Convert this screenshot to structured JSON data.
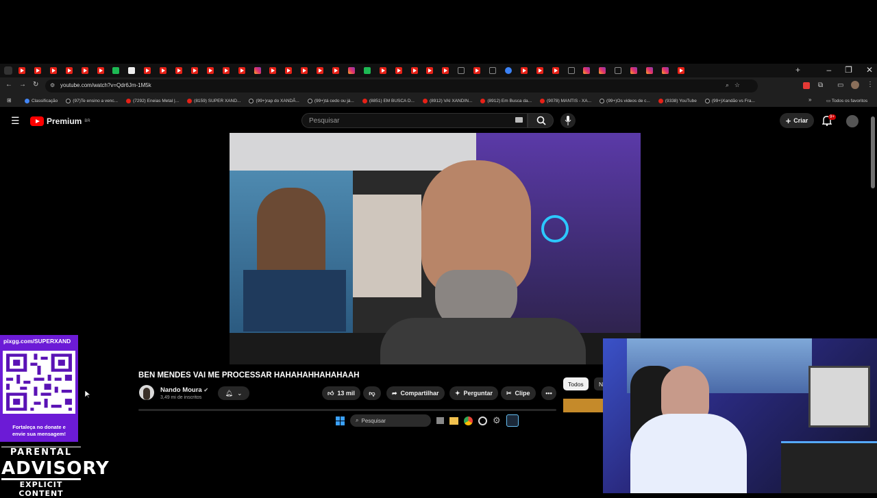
{
  "browser": {
    "url": "youtube.com/watch?v=Qdr6Jm-1M5k",
    "tab_types": [
      "yt",
      "yt",
      "yt",
      "yt",
      "yt",
      "yt",
      "gr",
      "wh",
      "yt",
      "yt",
      "yt",
      "yt",
      "yt",
      "yt",
      "yt",
      "ig",
      "yt",
      "yt",
      "yt",
      "yt",
      "yt",
      "ig",
      "gr",
      "yt",
      "yt",
      "yt",
      "yt",
      "yt",
      "tt",
      "yt",
      "tt",
      "bl",
      "yt",
      "yt",
      "yt",
      "tt",
      "ig",
      "ig",
      "tt",
      "ig",
      "ig",
      "ig",
      "yt"
    ],
    "bookmarks": [
      {
        "label": "Classificação",
        "icon": "g"
      },
      {
        "label": "(97)Te ensino a venc...",
        "icon": "t"
      },
      {
        "label": "(7292) Eneias Metal |...",
        "icon": "y"
      },
      {
        "label": "(8159) SUPER XAND...",
        "icon": "y"
      },
      {
        "label": "(99+)rap do XANDÃ...",
        "icon": "t"
      },
      {
        "label": "(99+)tá cedo ou já...",
        "icon": "t"
      },
      {
        "label": "(8851) EM BUSCA D...",
        "icon": "y"
      },
      {
        "label": "(8912) VAI XANDIN...",
        "icon": "y"
      },
      {
        "label": "(8912) Em Busca da...",
        "icon": "y"
      },
      {
        "label": "(9078) MANTIS - XA...",
        "icon": "y"
      },
      {
        "label": "(99+)Os videos de c...",
        "icon": "t"
      },
      {
        "label": "(9338) YouTube",
        "icon": "y"
      },
      {
        "label": "(99+)Xandão vs Fra...",
        "icon": "t"
      }
    ],
    "all_bookmarks_label": "Todos os favoritos"
  },
  "youtube": {
    "logo_text": "Premium",
    "logo_region": "BR",
    "search_placeholder": "Pesquisar",
    "create_label": "Criar",
    "notification_badge": "9+",
    "video_title": "BEN MENDES VAI ME PROCESSAR HAHAHAHHAHAHAAH",
    "channel_name": "Nando Moura",
    "subscribers": "3,49 mi de inscritos",
    "like_count": "13 mil",
    "share_label": "Compartilhar",
    "ask_label": "Perguntar",
    "clip_label": "Clipe",
    "chips": [
      "Todos",
      "N"
    ]
  },
  "taskbar": {
    "search_placeholder": "Pesquisar"
  },
  "overlay": {
    "donate_url": "pixgg.com/SUPERXAND",
    "donate_message_line1": "Fortaleça no donate e",
    "donate_message_line2": "envie sua mensagem!",
    "advisory_line1": "PARENTAL",
    "advisory_line2": "ADVISORY",
    "advisory_line3": "EXPLICIT CONTENT"
  },
  "colors": {
    "youtube_red": "#ff0000",
    "donate_purple": "#6c1bd6",
    "badge_red": "#cc0000"
  }
}
